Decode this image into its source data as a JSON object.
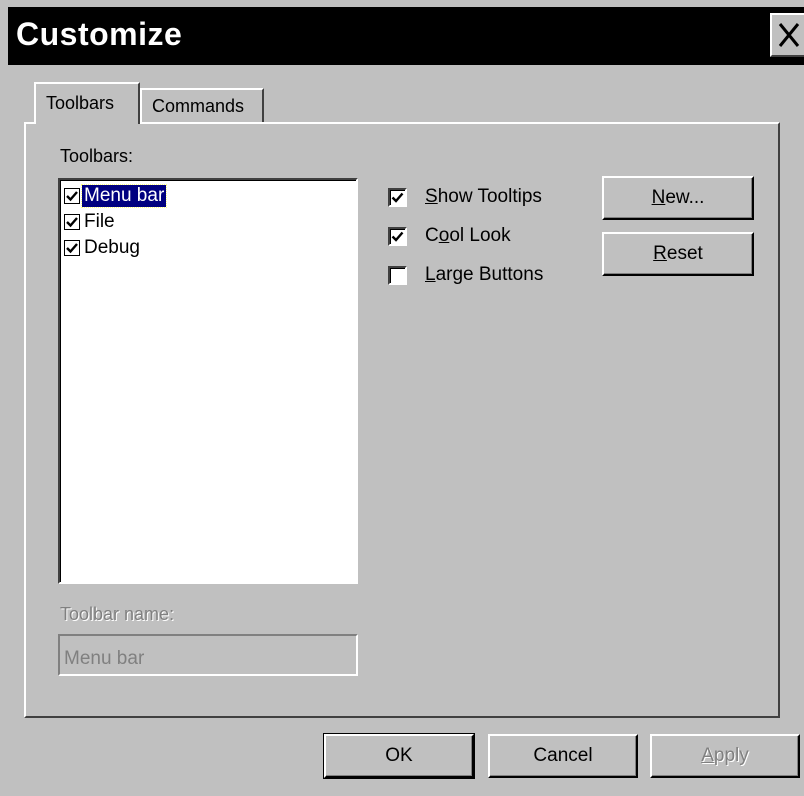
{
  "window": {
    "title": "Customize"
  },
  "tabs": [
    {
      "label": "Toolbars",
      "active": true
    },
    {
      "label": "Commands",
      "active": false
    }
  ],
  "toolbars_label": "Toolbars:",
  "toolbar_list": [
    {
      "label": "Menu bar",
      "checked": true,
      "selected": true
    },
    {
      "label": "File",
      "checked": true,
      "selected": false
    },
    {
      "label": "Debug",
      "checked": true,
      "selected": false
    }
  ],
  "options": [
    {
      "mnemonic": "S",
      "rest": "how Tooltips",
      "checked": true
    },
    {
      "before": "C",
      "mnemonic": "o",
      "rest": "ol Look",
      "checked": true
    },
    {
      "mnemonic": "L",
      "rest": "arge Buttons",
      "checked": false
    }
  ],
  "side_buttons": {
    "new": {
      "mnemonic": "N",
      "rest": "ew..."
    },
    "reset": {
      "mnemonic": "R",
      "rest": "eset"
    }
  },
  "toolbar_name": {
    "label": "Toolbar name:",
    "value": "Menu bar"
  },
  "footer": {
    "ok": "OK",
    "cancel": "Cancel",
    "apply_mnemonic": "A",
    "apply_rest": "pply"
  },
  "colors": {
    "face": "#c0c0c0",
    "titlebar": "#000000",
    "selection": "#000080"
  },
  "icons": {
    "close": "close-icon",
    "check": "check-icon"
  }
}
